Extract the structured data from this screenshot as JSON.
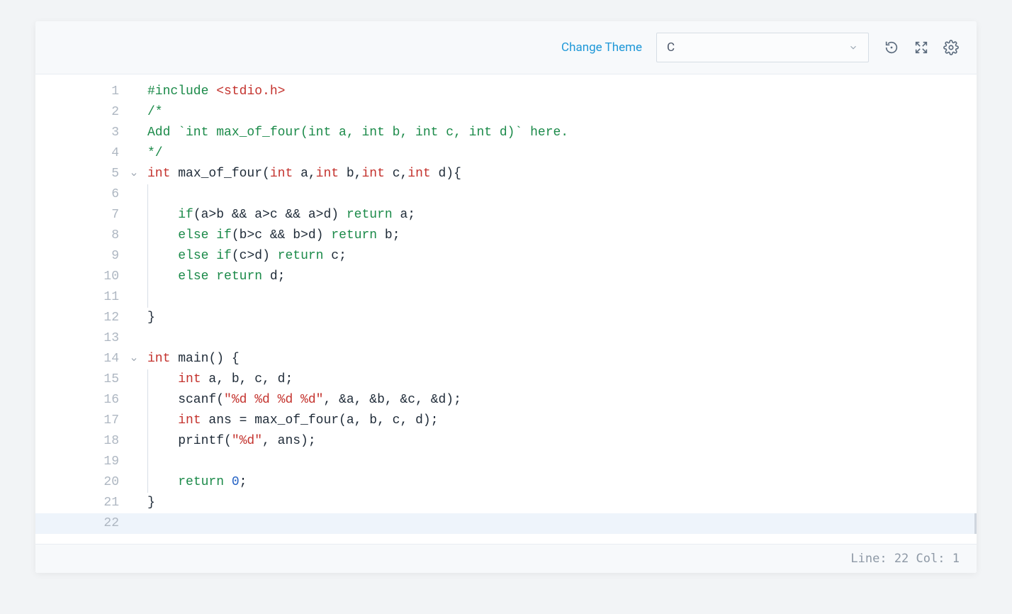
{
  "toolbar": {
    "change_theme": "Change Theme",
    "language": "C"
  },
  "icons": {
    "reset": "reset-icon",
    "fullscreen": "fullscreen-icon",
    "settings": "gear-icon",
    "chevron_down": "chevron-down-icon",
    "fold": "fold-toggle-icon"
  },
  "code": {
    "lines": [
      {
        "n": 1,
        "fold": false,
        "tokens": [
          [
            "kw",
            "#include"
          ],
          [
            "op",
            " "
          ],
          [
            "type",
            "<stdio.h>"
          ]
        ]
      },
      {
        "n": 2,
        "fold": false,
        "tokens": [
          [
            "cm",
            "/*"
          ]
        ]
      },
      {
        "n": 3,
        "fold": false,
        "tokens": [
          [
            "cm",
            "Add `int max_of_four(int a, int b, int c, int d)` here."
          ]
        ]
      },
      {
        "n": 4,
        "fold": false,
        "tokens": [
          [
            "cm",
            "*/"
          ]
        ]
      },
      {
        "n": 5,
        "fold": true,
        "tokens": [
          [
            "type",
            "int"
          ],
          [
            "op",
            " "
          ],
          [
            "fn",
            "max_of_four"
          ],
          [
            "op",
            "("
          ],
          [
            "type",
            "int"
          ],
          [
            "op",
            " a,"
          ],
          [
            "type",
            "int"
          ],
          [
            "op",
            " b,"
          ],
          [
            "type",
            "int"
          ],
          [
            "op",
            " c,"
          ],
          [
            "type",
            "int"
          ],
          [
            "op",
            " d){"
          ]
        ]
      },
      {
        "n": 6,
        "fold": false,
        "indent": 1,
        "tokens": []
      },
      {
        "n": 7,
        "fold": false,
        "indent": 1,
        "tokens": [
          [
            "op",
            "    "
          ],
          [
            "kw",
            "if"
          ],
          [
            "op",
            "(a>b && a>c && a>d) "
          ],
          [
            "kw",
            "return"
          ],
          [
            "op",
            " a;"
          ]
        ]
      },
      {
        "n": 8,
        "fold": false,
        "indent": 1,
        "tokens": [
          [
            "op",
            "    "
          ],
          [
            "kw",
            "else"
          ],
          [
            "op",
            " "
          ],
          [
            "kw",
            "if"
          ],
          [
            "op",
            "(b>c && b>d) "
          ],
          [
            "kw",
            "return"
          ],
          [
            "op",
            " b;"
          ]
        ]
      },
      {
        "n": 9,
        "fold": false,
        "indent": 1,
        "tokens": [
          [
            "op",
            "    "
          ],
          [
            "kw",
            "else"
          ],
          [
            "op",
            " "
          ],
          [
            "kw",
            "if"
          ],
          [
            "op",
            "(c>d) "
          ],
          [
            "kw",
            "return"
          ],
          [
            "op",
            " c;"
          ]
        ]
      },
      {
        "n": 10,
        "fold": false,
        "indent": 1,
        "tokens": [
          [
            "op",
            "    "
          ],
          [
            "kw",
            "else"
          ],
          [
            "op",
            " "
          ],
          [
            "kw",
            "return"
          ],
          [
            "op",
            " d;"
          ]
        ]
      },
      {
        "n": 11,
        "fold": false,
        "indent": 1,
        "tokens": []
      },
      {
        "n": 12,
        "fold": false,
        "tokens": [
          [
            "op",
            "}"
          ]
        ]
      },
      {
        "n": 13,
        "fold": false,
        "tokens": []
      },
      {
        "n": 14,
        "fold": true,
        "tokens": [
          [
            "type",
            "int"
          ],
          [
            "op",
            " "
          ],
          [
            "fn",
            "main"
          ],
          [
            "op",
            "() {"
          ]
        ]
      },
      {
        "n": 15,
        "fold": false,
        "indent": 1,
        "tokens": [
          [
            "op",
            "    "
          ],
          [
            "type",
            "int"
          ],
          [
            "op",
            " a, b, c, d;"
          ]
        ]
      },
      {
        "n": 16,
        "fold": false,
        "indent": 1,
        "tokens": [
          [
            "op",
            "    scanf("
          ],
          [
            "str",
            "\"%d %d %d %d\""
          ],
          [
            "op",
            ", &a, &b, &c, &d);"
          ]
        ]
      },
      {
        "n": 17,
        "fold": false,
        "indent": 1,
        "tokens": [
          [
            "op",
            "    "
          ],
          [
            "type",
            "int"
          ],
          [
            "op",
            " ans = max_of_four(a, b, c, d);"
          ]
        ]
      },
      {
        "n": 18,
        "fold": false,
        "indent": 1,
        "tokens": [
          [
            "op",
            "    printf("
          ],
          [
            "str",
            "\"%d\""
          ],
          [
            "op",
            ", ans);"
          ]
        ]
      },
      {
        "n": 19,
        "fold": false,
        "indent": 1,
        "tokens": []
      },
      {
        "n": 20,
        "fold": false,
        "indent": 1,
        "tokens": [
          [
            "op",
            "    "
          ],
          [
            "kw",
            "return"
          ],
          [
            "op",
            " "
          ],
          [
            "num",
            "0"
          ],
          [
            "op",
            ";"
          ]
        ]
      },
      {
        "n": 21,
        "fold": false,
        "tokens": [
          [
            "op",
            "}"
          ]
        ]
      },
      {
        "n": 22,
        "fold": false,
        "current": true,
        "tokens": []
      }
    ]
  },
  "status": {
    "line_label": "Line:",
    "line": "22",
    "col_label": "Col:",
    "col": "1"
  }
}
